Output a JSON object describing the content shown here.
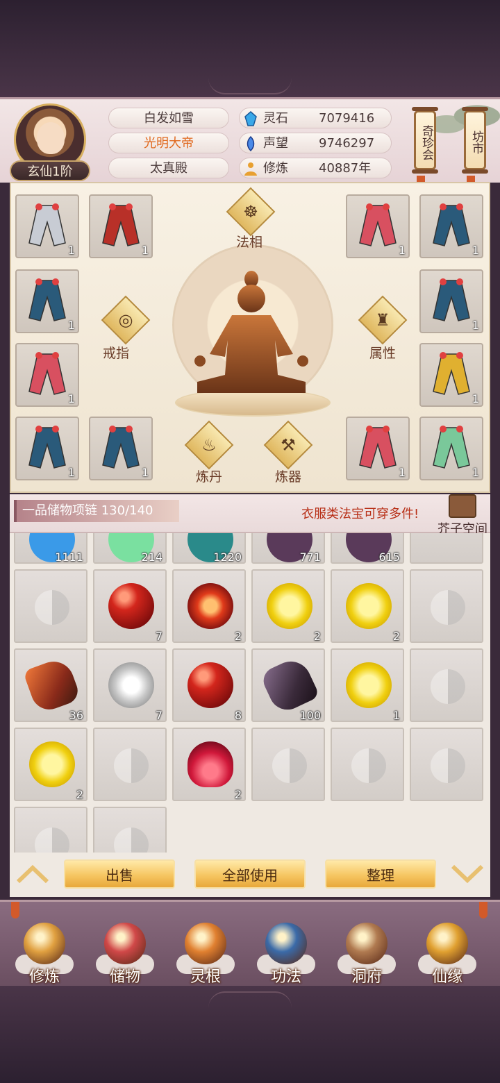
{
  "player": {
    "rank": "玄仙1阶",
    "names": [
      "白发如雪",
      "光明大帝",
      "太真殿"
    ],
    "stats": [
      {
        "icon": "spirit-stone-icon",
        "label": "灵石",
        "value": "7079416"
      },
      {
        "icon": "reputation-icon",
        "label": "声望",
        "value": "9746297"
      },
      {
        "icon": "cultivation-icon",
        "label": "修炼",
        "value": "40887年"
      }
    ]
  },
  "shortcuts": {
    "treasure": "奇珍会",
    "market": "坊市"
  },
  "equipment": {
    "center_label": "法相",
    "left_label": "戒指",
    "right_label": "属性",
    "bottom_left_label": "炼丹",
    "bottom_right_label": "炼器",
    "slots": [
      {
        "item": "silver-boots",
        "count": "1"
      },
      {
        "item": "red-bow",
        "count": "1"
      },
      {
        "item": "red-robe",
        "count": "1"
      },
      {
        "item": "blue-robe",
        "count": "1"
      },
      {
        "item": "blue-robe",
        "count": "1"
      },
      {
        "item": "blue-robe",
        "count": "1"
      },
      {
        "item": "red-robe",
        "count": "1"
      },
      {
        "item": "golden-armor",
        "count": "1"
      },
      {
        "item": "blue-robe",
        "count": "1"
      },
      {
        "item": "blue-robe",
        "count": "1"
      },
      {
        "item": "red-robe",
        "count": "1"
      },
      {
        "item": "green-robe",
        "count": "1"
      }
    ]
  },
  "bag": {
    "title": "一品储物项链 130/140",
    "tip": "衣服类法宝可穿多件!",
    "space_label": "芥子空间",
    "partial_row": [
      {
        "item": "blue-orb",
        "count": "1111"
      },
      {
        "item": "green-crystal",
        "count": "214"
      },
      {
        "item": "teal-shard",
        "count": "1220"
      },
      {
        "item": "dark-ore",
        "count": "771"
      },
      {
        "item": "dark-ore",
        "count": "615"
      },
      {
        "item": "",
        "count": ""
      }
    ],
    "rows": [
      [
        {
          "item": "",
          "count": ""
        },
        {
          "item": "orb-red",
          "count": "7"
        },
        {
          "item": "orb-swirl",
          "count": "2"
        },
        {
          "item": "orb-yellow",
          "count": "2"
        },
        {
          "item": "orb-yellow",
          "count": "2"
        },
        {
          "item": "",
          "count": ""
        }
      ],
      [
        {
          "item": "rock-red",
          "count": "36"
        },
        {
          "item": "orb-white",
          "count": "7"
        },
        {
          "item": "orb-red",
          "count": "8"
        },
        {
          "item": "rock-dark",
          "count": "100"
        },
        {
          "item": "orb-yellow",
          "count": "1"
        },
        {
          "item": "",
          "count": ""
        }
      ],
      [
        {
          "item": "orb-yellow",
          "count": "2"
        },
        {
          "item": "",
          "count": ""
        },
        {
          "item": "flame",
          "count": "2"
        },
        {
          "item": "",
          "count": ""
        },
        {
          "item": "",
          "count": ""
        },
        {
          "item": "",
          "count": ""
        }
      ]
    ]
  },
  "actions": {
    "sell": "出售",
    "use_all": "全部使用",
    "sort": "整理"
  },
  "nav": [
    {
      "icon": "monk-icon",
      "label": "修炼"
    },
    {
      "icon": "bag-icon",
      "label": "储物"
    },
    {
      "icon": "spirit-root-icon",
      "label": "灵根"
    },
    {
      "icon": "book-icon",
      "label": "功法"
    },
    {
      "icon": "cave-house-icon",
      "label": "洞府"
    },
    {
      "icon": "gourd-icon",
      "label": "仙缘"
    }
  ]
}
